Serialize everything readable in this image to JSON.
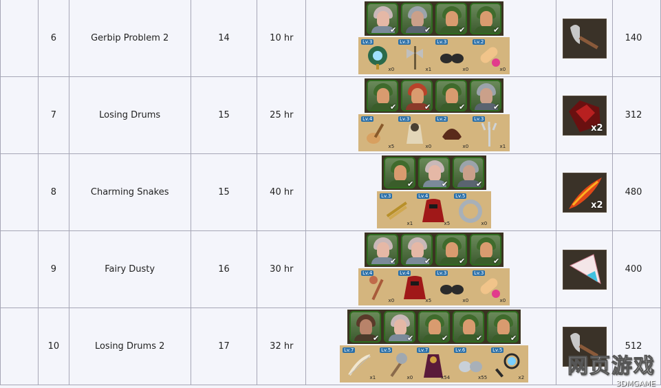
{
  "rows": [
    {
      "num": "6",
      "name": "Gerbip Problem 2",
      "level": "14",
      "time": "10 hr",
      "heroes": [
        "elf",
        "knight",
        "ranger",
        "ranger"
      ],
      "items": [
        {
          "icon": "orb-icon",
          "lv": "Lv.3",
          "qty": "x0"
        },
        {
          "icon": "axe-icon",
          "lv": "Lv.3",
          "qty": "x1"
        },
        {
          "icon": "boots-icon",
          "lv": "Lv.3",
          "qty": "x0"
        },
        {
          "icon": "scroll-icon",
          "lv": "Lv.2",
          "qty": "x0"
        }
      ],
      "reward": {
        "icon": "hammer-icon",
        "qty": ""
      },
      "gold": "140"
    },
    {
      "num": "7",
      "name": "Losing Drums",
      "level": "15",
      "time": "25 hr",
      "heroes": [
        "ranger",
        "bard",
        "ranger",
        "knight"
      ],
      "items": [
        {
          "icon": "lute-icon",
          "lv": "Lv.4",
          "qty": "x5"
        },
        {
          "icon": "armor-icon",
          "lv": "Lv.3",
          "qty": "x0"
        },
        {
          "icon": "helmet-icon",
          "lv": "Lv.2",
          "qty": "x0"
        },
        {
          "icon": "trident-icon",
          "lv": "Lv.3",
          "qty": "x1"
        }
      ],
      "reward": {
        "icon": "ore-icon",
        "qty": "x2"
      },
      "gold": "312"
    },
    {
      "num": "8",
      "name": "Charming Snakes",
      "level": "15",
      "time": "40 hr",
      "heroes": [
        "ranger",
        "elf",
        "knight"
      ],
      "items": [
        {
          "icon": "flute-icon",
          "lv": "Lv.3",
          "qty": "x1"
        },
        {
          "icon": "cloak-icon",
          "lv": "Lv.4",
          "qty": "x5"
        },
        {
          "icon": "ring-icon",
          "lv": "Lv.5",
          "qty": "x0"
        }
      ],
      "reward": {
        "icon": "feather-icon",
        "qty": "x2"
      },
      "gold": "480"
    },
    {
      "num": "9",
      "name": "Fairy Dusty",
      "level": "16",
      "time": "30 hr",
      "heroes": [
        "elf",
        "elf",
        "ranger",
        "ranger"
      ],
      "items": [
        {
          "icon": "staff-icon",
          "lv": "Lv.4",
          "qty": "x0"
        },
        {
          "icon": "cloak-icon",
          "lv": "Lv.4",
          "qty": "x5"
        },
        {
          "icon": "boots-icon",
          "lv": "Lv.3",
          "qty": "x0"
        },
        {
          "icon": "scroll-icon",
          "lv": "Lv.3",
          "qty": "x0"
        }
      ],
      "reward": {
        "icon": "crystal-icon",
        "qty": ""
      },
      "gold": "400"
    },
    {
      "num": "10",
      "name": "Losing Drums 2",
      "level": "17",
      "time": "32 hr",
      "heroes": [
        "warrior",
        "elf",
        "ranger",
        "ranger",
        "ranger"
      ],
      "items": [
        {
          "icon": "bow-icon",
          "lv": "Lv.7",
          "qty": "x1"
        },
        {
          "icon": "mace-icon",
          "lv": "Lv.5",
          "qty": "x0"
        },
        {
          "icon": "robe-icon",
          "lv": "Lv.7",
          "qty": "x54"
        },
        {
          "icon": "gauntlet-icon",
          "lv": "Lv.6",
          "qty": "x55"
        },
        {
          "icon": "lens-icon",
          "lv": "Lv.5",
          "qty": "x2"
        }
      ],
      "reward": {
        "icon": "hammer-icon",
        "qty": ""
      },
      "gold": "512"
    }
  ],
  "watermark": {
    "main": "网页游戏",
    "sub": "3DMGAME"
  }
}
